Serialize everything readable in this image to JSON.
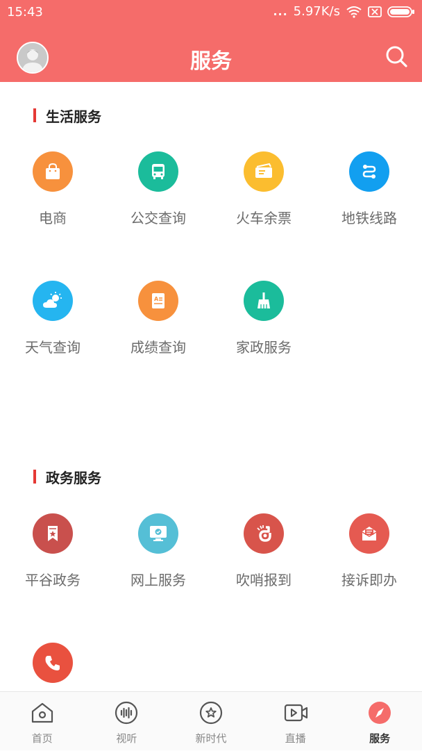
{
  "status": {
    "time": "15:43",
    "dots": "...",
    "speed": "5.97K/s"
  },
  "header": {
    "title": "服务"
  },
  "sections": [
    {
      "title": "生活服务",
      "items": [
        {
          "label": "电商",
          "icon": "shopping-bag-icon",
          "color": "#f7913d"
        },
        {
          "label": "公交查询",
          "icon": "bus-icon",
          "color": "#1bbc9b"
        },
        {
          "label": "火车余票",
          "icon": "ticket-icon",
          "color": "#fbbd2f"
        },
        {
          "label": "地铁线路",
          "icon": "subway-route-icon",
          "color": "#129ff0"
        },
        {
          "label": "天气查询",
          "icon": "weather-icon",
          "color": "#25b5f0"
        },
        {
          "label": "成绩查询",
          "icon": "report-card-icon",
          "color": "#f7913d"
        },
        {
          "label": "家政服务",
          "icon": "broom-icon",
          "color": "#1bbc9b"
        }
      ]
    },
    {
      "title": "政务服务",
      "items": [
        {
          "label": "平谷政务",
          "icon": "government-badge-icon",
          "color": "#c9504d"
        },
        {
          "label": "网上服务",
          "icon": "monitor-icon",
          "color": "#55bfd6"
        },
        {
          "label": "吹哨报到",
          "icon": "whistle-icon",
          "color": "#d8544b"
        },
        {
          "label": "接诉即办",
          "icon": "mail-icon",
          "color": "#e55a51"
        },
        {
          "label": "",
          "icon": "phone-icon",
          "color": "#e9513f"
        }
      ]
    }
  ],
  "tabbar": [
    {
      "label": "首页",
      "icon": "home-icon"
    },
    {
      "label": "视听",
      "icon": "audio-wave-icon"
    },
    {
      "label": "新时代",
      "icon": "star-circle-icon"
    },
    {
      "label": "直播",
      "icon": "video-icon"
    },
    {
      "label": "服务",
      "icon": "compass-icon",
      "active": true,
      "color": "#f56c6a"
    }
  ]
}
